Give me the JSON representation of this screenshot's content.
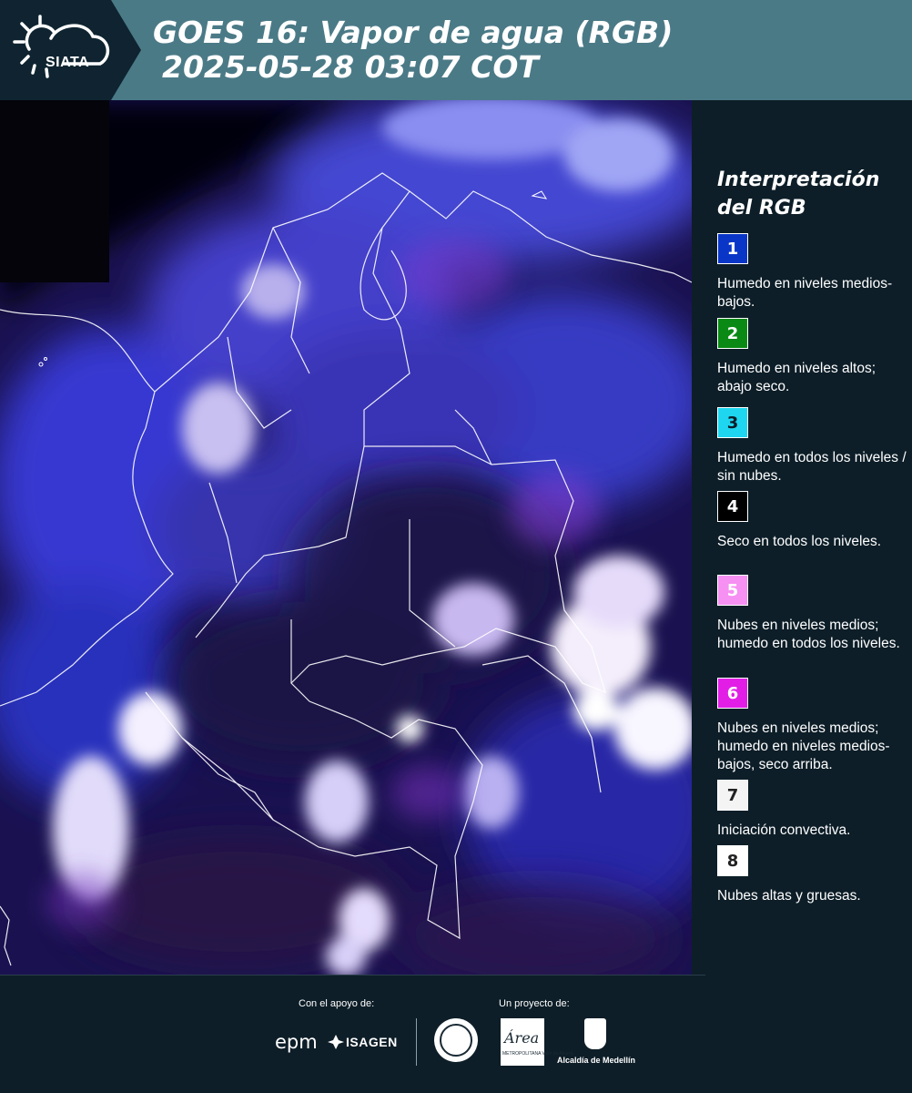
{
  "header": {
    "logo_text": "SIATA",
    "title_line1": "GOES 16: Vapor de agua (RGB)",
    "title_line2": "2025-05-28 03:07 COT"
  },
  "map": {
    "icon": "satellite-map-image"
  },
  "legend": {
    "title_line1": "Interpretación",
    "title_line2": "del RGB",
    "items": [
      {
        "number": "1",
        "text": "Humedo en niveles medios-bajos.",
        "color": "#0a36c8",
        "text_color": "#ffffff"
      },
      {
        "number": "2",
        "text": "Humedo en niveles altos; abajo seco.",
        "color": "#0a8a14",
        "text_color": "#ffffff"
      },
      {
        "number": "3",
        "text": "Humedo en todos los niveles / sin nubes.",
        "color": "#1ed6f0",
        "text_color": "#0d1e28"
      },
      {
        "number": "4",
        "text": "Seco en todos los niveles.",
        "color": "#000000",
        "text_color": "#ffffff"
      },
      {
        "number": "5",
        "text": "Nubes en niveles medios; humedo en todos los niveles.",
        "color": "#f690f2",
        "text_color": "#ffffff"
      },
      {
        "number": "6",
        "text": "Nubes en niveles medios; humedo en niveles medios-bajos, seco arriba.",
        "color": "#e21ee6",
        "text_color": "#ffffff"
      },
      {
        "number": "7",
        "text": "Iniciación convectiva.",
        "color": "#f4f4f4",
        "text_color": "#222222"
      },
      {
        "number": "8",
        "text": "Nubes altas y gruesas.",
        "color": "#ffffff",
        "text_color": "#222222"
      }
    ]
  },
  "footer": {
    "support_label": "Con el apoyo de:",
    "project_label": "Un proyecto de:",
    "epm": "epm",
    "isagen": "ISAGEN",
    "area_logo": "Área",
    "area_sub": "METROPOLITANA Valle de Aburrá",
    "alcaldia": "Alcaldía de Medellín"
  }
}
